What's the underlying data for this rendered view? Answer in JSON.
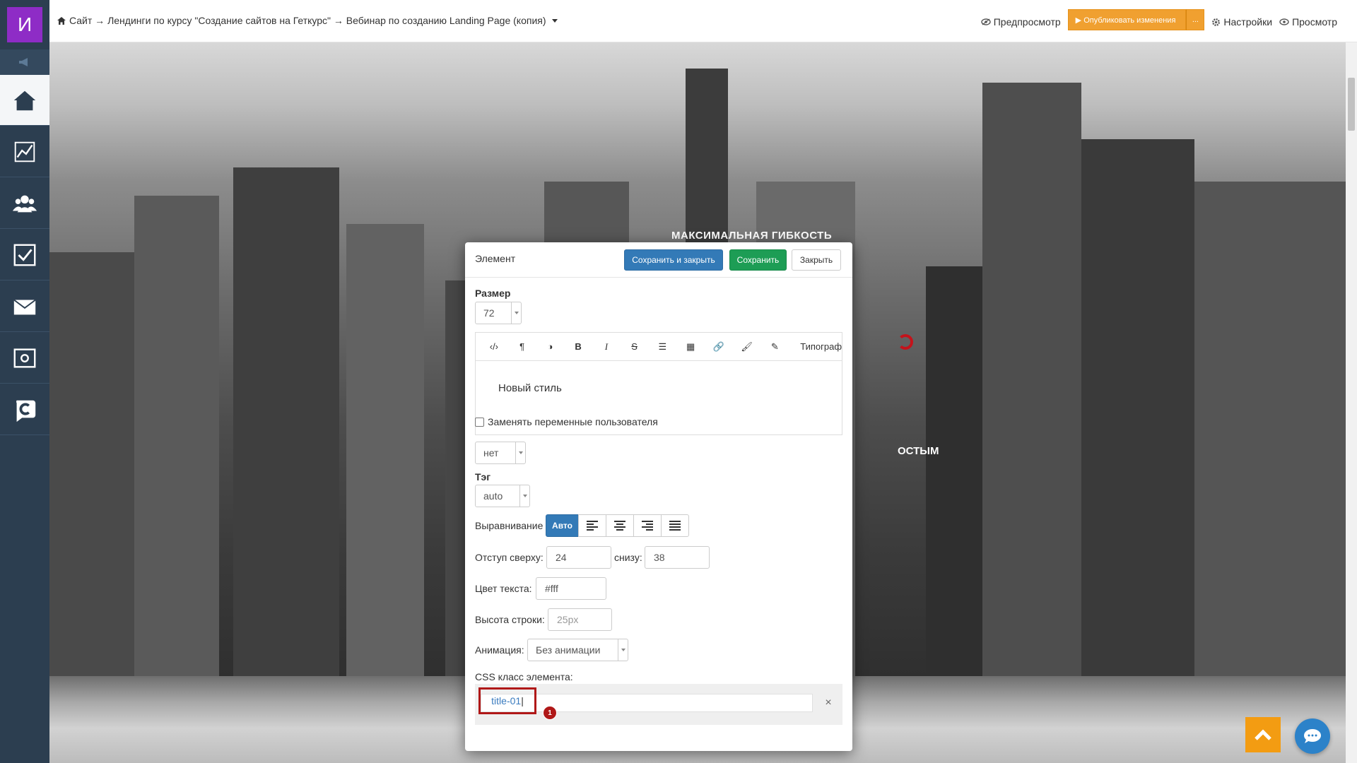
{
  "app": {
    "logo_letter": "И",
    "brand_color": "#8e2cc6"
  },
  "sidebar": {
    "items": [
      {
        "icon": "home-icon",
        "active": true
      },
      {
        "icon": "chart-icon",
        "active": false
      },
      {
        "icon": "users-icon",
        "active": false
      },
      {
        "icon": "checkbox-icon",
        "active": false
      },
      {
        "icon": "mail-icon",
        "active": false
      },
      {
        "icon": "settings-box-icon",
        "active": false
      },
      {
        "icon": "getcourse-icon",
        "active": false
      }
    ]
  },
  "topbar": {
    "breadcrumb": "Сайт → Лендинги по курсу \"Создание сайтов на Геткурс\" → Вебинар по созданию Landing Page (копия)",
    "preview_label": "Предпросмотр",
    "publish_label": "▶ Опубликовать изменения",
    "publish_more": "...",
    "settings_label": "Настройки",
    "view_label": "Просмотр"
  },
  "hero": {
    "title": "МАКСИМАЛЬНАЯ ГИБКОСТЬ",
    "fragment": "ОСТЫМ"
  },
  "modal": {
    "title": "Элемент",
    "save_close_label": "Сохранить и закрыть",
    "save_label": "Сохранить",
    "close_label": "Закрыть",
    "size_label": "Размер",
    "size_value": "72",
    "toolbar_typograf": "Типограф",
    "editor_text": "Новый стиль",
    "replace_vars_label": "Заменять переменные пользователя",
    "replace_vars_checked": false,
    "vars_select_value": "нет",
    "tag_label": "Тэг",
    "tag_value": "auto",
    "align_label": "Выравнивание",
    "align_auto": "Авто",
    "padding_top_label": "Отступ сверху:",
    "padding_top_value": "24",
    "padding_bottom_label": "снизу:",
    "padding_bottom_value": "38",
    "text_color_label": "Цвет текста:",
    "text_color_value": "#fff",
    "line_height_label": "Высота строки:",
    "line_height_placeholder": "25px",
    "animation_label": "Анимация:",
    "animation_value": "Без анимации",
    "css_class_label": "CSS класс элемента:",
    "css_class_value": "title-01",
    "badge_number": "1",
    "clear_symbol": "×"
  },
  "colors": {
    "primary": "#337ab7",
    "success": "#1d9d55",
    "publish": "#f0a030",
    "highlight": "#b01818",
    "to_top": "#f39c12",
    "chat": "#2c82c9"
  }
}
